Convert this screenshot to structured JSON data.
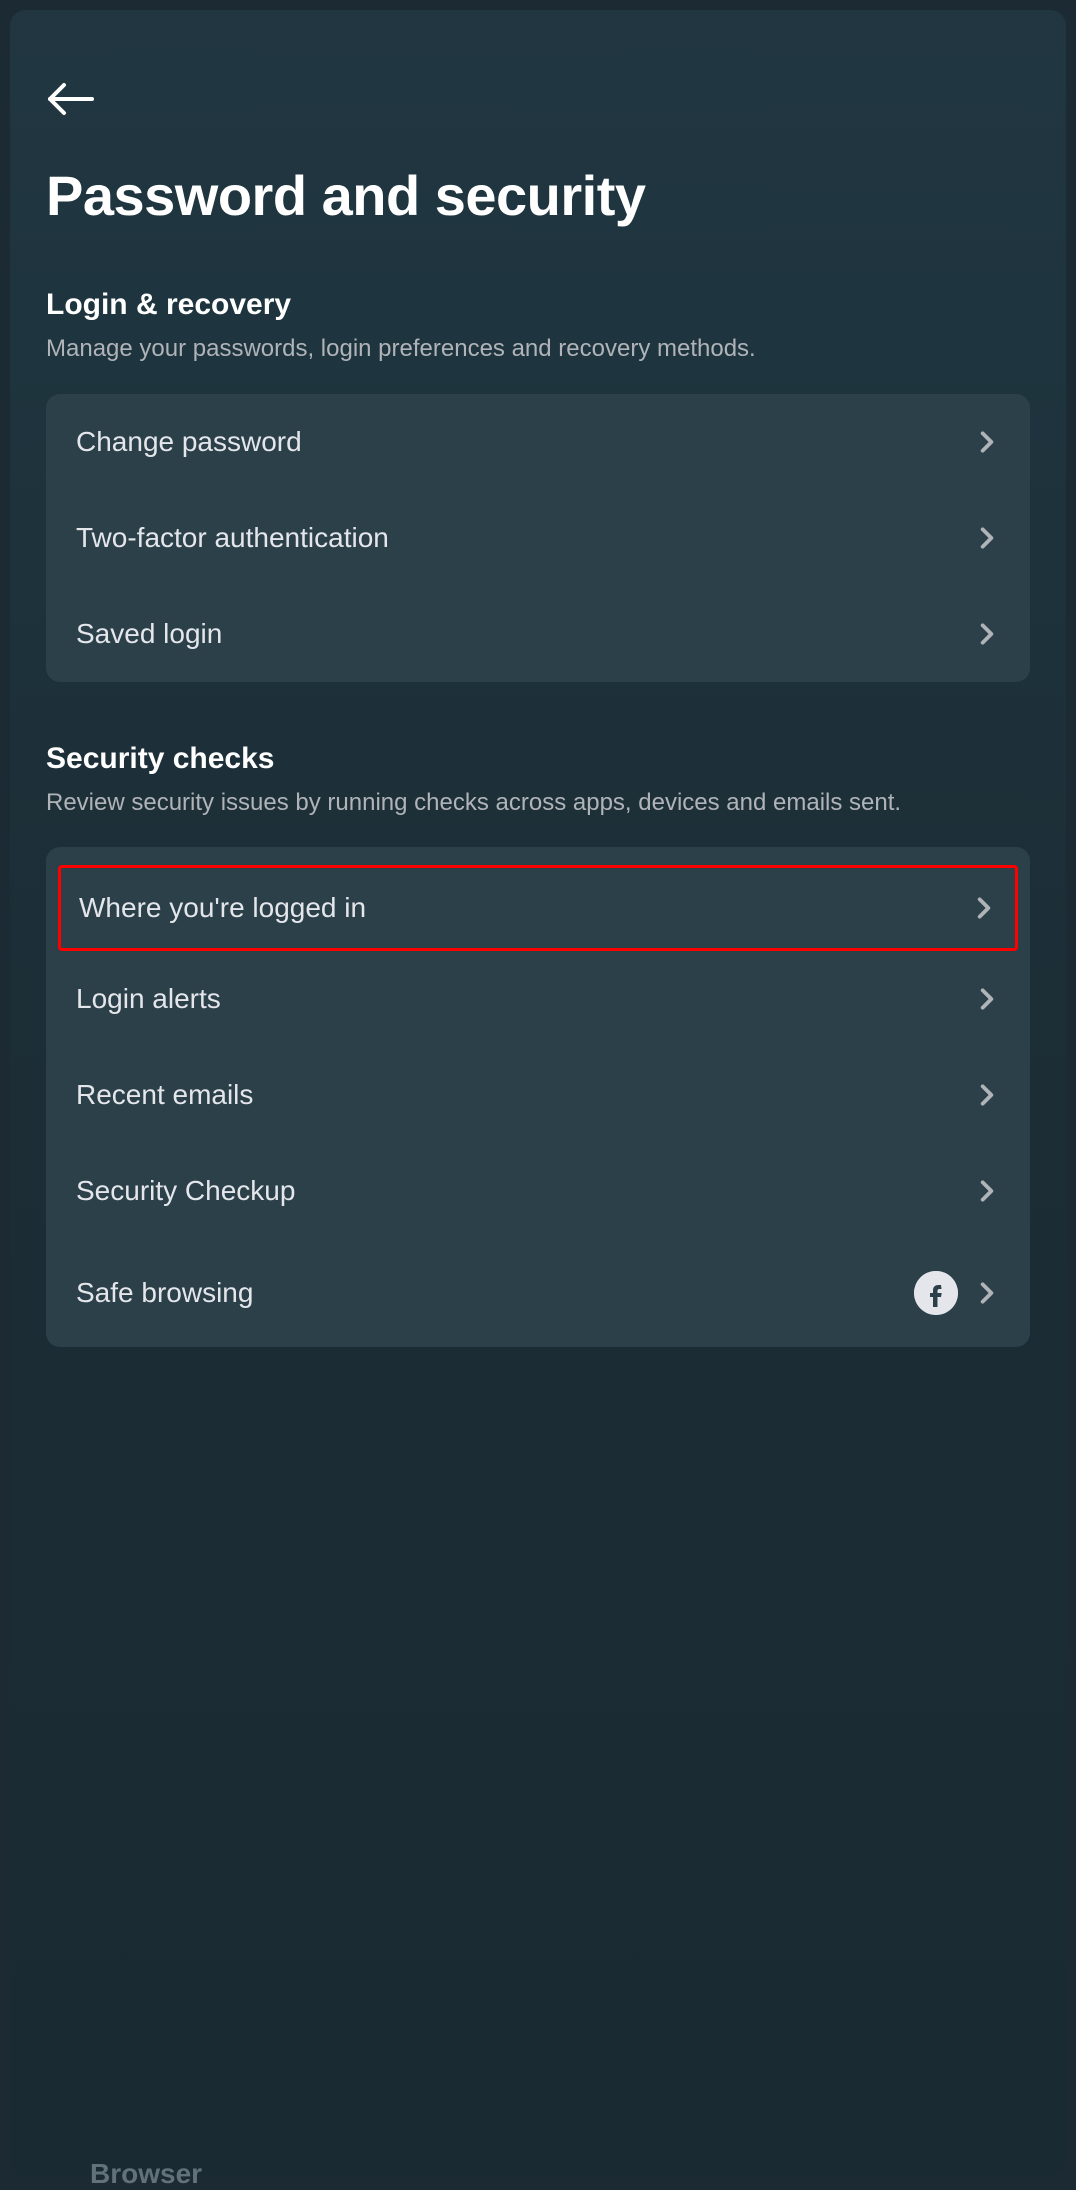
{
  "page_title": "Password and security",
  "sections": [
    {
      "title": "Login & recovery",
      "subtitle": "Manage your passwords, login preferences and recovery methods.",
      "items": [
        {
          "label": "Change password"
        },
        {
          "label": "Two-factor authentication"
        },
        {
          "label": "Saved login"
        }
      ]
    },
    {
      "title": "Security checks",
      "subtitle": "Review security issues by running checks across apps, devices and emails sent.",
      "items": [
        {
          "label": "Where you're logged in"
        },
        {
          "label": "Login alerts"
        },
        {
          "label": "Recent emails"
        },
        {
          "label": "Security Checkup"
        },
        {
          "label": "Safe browsing"
        }
      ]
    }
  ],
  "cutoff_text": "Browser"
}
